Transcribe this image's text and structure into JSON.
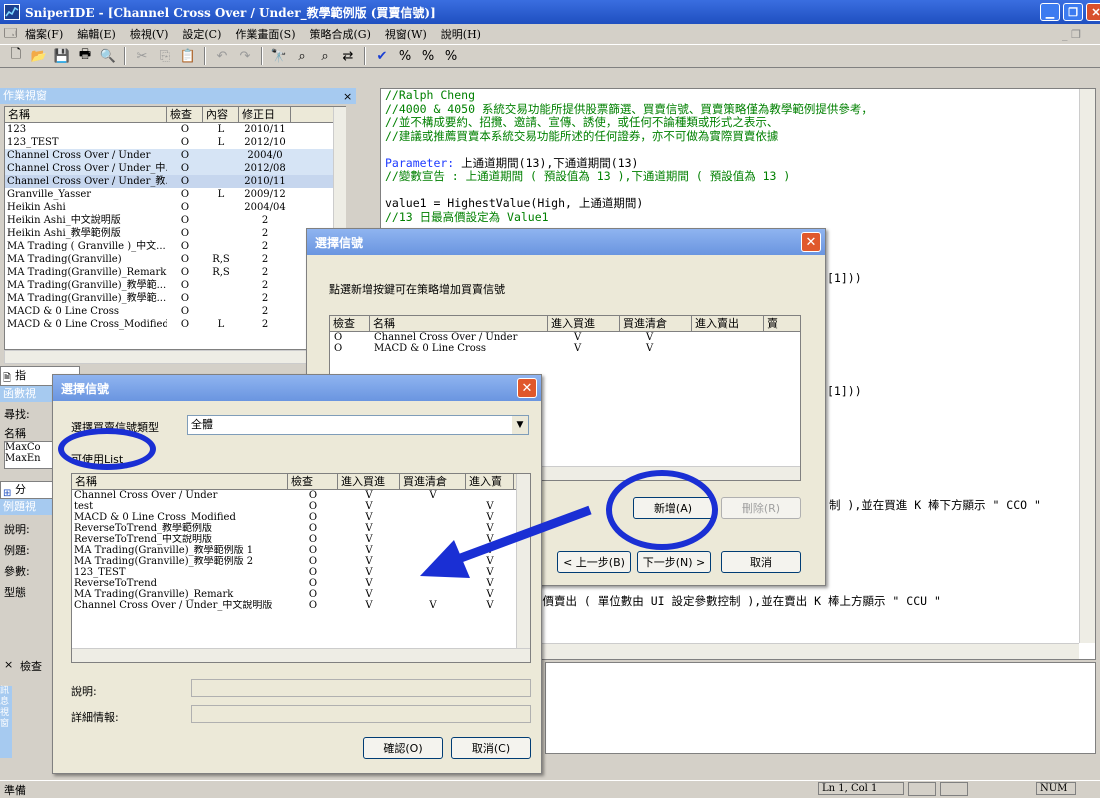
{
  "app": {
    "title": "SniperIDE - [Channel Cross Over / Under_教學範例版 (買賣信號)]"
  },
  "menu": [
    "檔案(F)",
    "編輯(E)",
    "檢視(V)",
    "設定(C)",
    "作業畫面(S)",
    "策略合成(G)",
    "視窗(W)",
    "說明(H)"
  ],
  "workspace": {
    "title": "作業視窗",
    "columns": [
      "名稱",
      "檢查",
      "內容",
      "修正日"
    ],
    "rows": [
      [
        "123",
        "O",
        "L",
        "2010/11"
      ],
      [
        "123_TEST",
        "O",
        "L",
        "2012/10"
      ],
      [
        "Channel Cross Over / Under",
        "O",
        "",
        "2004/0"
      ],
      [
        "Channel Cross Over / Under_中...",
        "O",
        "",
        "2012/08"
      ],
      [
        "Channel Cross Over / Under_教...",
        "O",
        "",
        "2010/11"
      ],
      [
        "Granville_Yasser",
        "O",
        "L",
        "2009/12"
      ],
      [
        "Heikin Ashi",
        "O",
        "",
        "2004/04"
      ],
      [
        "Heikin Ashi_中文說明版",
        "O",
        "",
        "2"
      ],
      [
        "Heikin Ashi_教學範例版",
        "O",
        "",
        "2"
      ],
      [
        "MA Trading ( Granville )_中文...",
        "O",
        "",
        "2"
      ],
      [
        "MA Trading(Granville)",
        "O",
        "R,S",
        "2"
      ],
      [
        "MA Trading(Granville)_Remark",
        "O",
        "R,S",
        "2"
      ],
      [
        "MA Trading(Granville)_教學範...",
        "O",
        "",
        "2"
      ],
      [
        "MA Trading(Granville)_教學範...",
        "O",
        "",
        "2"
      ],
      [
        "MACD & 0 Line Cross",
        "O",
        "",
        "2"
      ],
      [
        "MACD & 0 Line Cross_Modified",
        "O",
        "L",
        "2"
      ]
    ]
  },
  "left_panel": {
    "tab_indicator": "指",
    "func_title": "函數視",
    "find_label": "尋找:",
    "name_label": "名稱",
    "func_items": [
      "MaxCo",
      "MaxEn"
    ],
    "tab_category": "分",
    "example_title": "例題視",
    "desc_label": "說明:",
    "example_label": "例題:",
    "param_label": "參數:",
    "type_label": "型態",
    "bottom_close": "×",
    "bottom_check": "檢查",
    "bottom_vertical": "訊息視窗"
  },
  "editor": {
    "lines": [
      {
        "text": "//Ralph Cheng",
        "color": "green"
      },
      {
        "text": "//4000 & 4050 系統交易功能所提供股票篩選、買賣信號、買賣策略僅為教學範例提供參考，",
        "color": "green"
      },
      {
        "text": "//並不構成要約、招攬、邀請、宣傳、誘使，或任何不論種類或形式之表示、",
        "color": "green"
      },
      {
        "text": "//建議或推薦買賣本系統交易功能所述的任何證券，亦不可做為實際買賣依據",
        "color": "green"
      },
      {
        "text": "",
        "color": "black"
      },
      {
        "text": "Parameter: 上通道期間(13),下通道期間(13)",
        "color": "mixed1"
      },
      {
        "text": "//變數宣告 : 上通道期間 ( 預設值為 13 ),下通道期間 ( 預設值為 13 )",
        "color": "green"
      },
      {
        "text": "",
        "color": "black"
      },
      {
        "text": "value1 = HighestValue(High, 上通道期間)",
        "color": "mixed2"
      },
      {
        "text": "//13 日最高價設定為 Value1",
        "color": "green"
      }
    ],
    "frag1": "[1]))",
    "frag2": "[1]))",
    "frag3": "制 ),並在買進 K 棒下方顯示 \" CCO \"",
    "frag4": "行價賣出 ( 單位數由 UI 設定參數控制 ),並在賣出 K 棒上方顯示 \" CCU \""
  },
  "dialog1": {
    "title": "選擇信號",
    "instruction": "點選新增按鍵可在策略增加買賣信號",
    "columns": [
      "檢查",
      "名稱",
      "進入買進",
      "買進清倉",
      "進入賣出",
      "賣"
    ],
    "rows": [
      [
        "O",
        "Channel Cross Over / Under",
        "V",
        "V"
      ],
      [
        "O",
        "MACD & 0 Line Cross",
        "V",
        "V"
      ]
    ],
    "add_button": "新增(A)",
    "delete_button": "刪除(R)",
    "prev_button": "< 上一步(B)",
    "next_button": "下一步(N) >",
    "cancel_button": "取消"
  },
  "dialog2": {
    "title": "選擇信號",
    "type_label": "選擇買賣信號類型",
    "type_value": "全體",
    "list_label": "可使用List",
    "columns": [
      "名稱",
      "檢查",
      "進入買進",
      "買進清倉",
      "進入賣"
    ],
    "rows": [
      [
        "Channel Cross Over / Under",
        "O",
        "V",
        "V",
        ""
      ],
      [
        "test",
        "O",
        "V",
        "",
        "V"
      ],
      [
        "MACD & 0 Line Cross_Modified",
        "O",
        "V",
        "",
        "V"
      ],
      [
        "ReverseToTrend_教學範例版",
        "O",
        "V",
        "",
        "V"
      ],
      [
        "ReverseToTrend_中文說明版",
        "O",
        "V",
        "",
        "V"
      ],
      [
        "MA Trading(Granville)_教學範例版 1",
        "O",
        "V",
        "",
        "V"
      ],
      [
        "MA Trading(Granville)_教學範例版 2",
        "O",
        "V",
        "",
        "V"
      ],
      [
        "123_TEST",
        "O",
        "V",
        "",
        "V"
      ],
      [
        "ReverseToTrend",
        "O",
        "V",
        "",
        "V"
      ],
      [
        "MA Trading(Granville)_Remark",
        "O",
        "V",
        "",
        "V"
      ],
      [
        "Channel Cross Over / Under_中文說明版",
        "O",
        "V",
        "V",
        "V"
      ]
    ],
    "desc_label": "說明:",
    "detail_label": "詳細情報:",
    "ok_button": "確認(O)",
    "cancel_button": "取消(C)"
  },
  "status": {
    "ready": "準備",
    "position": "Ln 1, Col 1",
    "num": "NUM"
  },
  "colors": {
    "annotation": "#1a2fd4",
    "titlebar": "#2a5fd8",
    "comment": "#008000"
  }
}
